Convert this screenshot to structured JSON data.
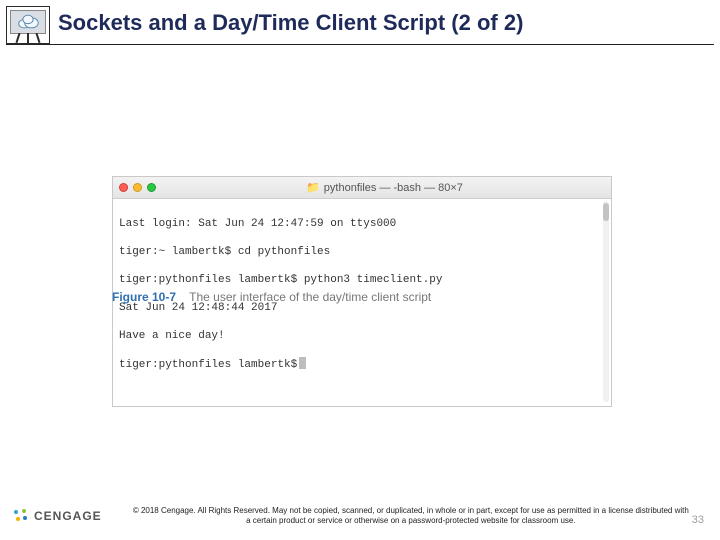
{
  "title": "Sockets and a Day/Time Client Script (2 of 2)",
  "terminal": {
    "windowTitle": "pythonfiles — -bash — 80×7",
    "lines": [
      "Last login: Sat Jun 24 12:47:59 on ttys000",
      "tiger:~ lambertk$ cd pythonfiles",
      "tiger:pythonfiles lambertk$ python3 timeclient.py",
      "Sat Jun 24 12:48:44 2017",
      "Have a nice day!",
      "tiger:pythonfiles lambertk$"
    ]
  },
  "caption": {
    "figLabel": "Figure 10-7",
    "text": "The user interface of the day/time client script"
  },
  "footer": {
    "brand": "CENGAGE",
    "copyright": "© 2018 Cengage. All Rights Reserved. May not be copied, scanned, or duplicated, in whole or in part, except for use as permitted in a license distributed with a certain product or service or otherwise on a password-protected website for classroom use.",
    "pageNumber": "33"
  },
  "iconNames": {
    "corner": "cloud-easel-icon",
    "folder": "folder-icon",
    "brand": "cengage-mark-icon"
  }
}
